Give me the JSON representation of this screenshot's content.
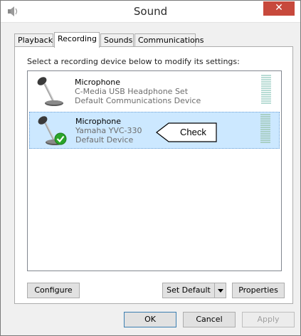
{
  "window": {
    "title": "Sound",
    "close_label": "✕"
  },
  "tabs": [
    {
      "label": "Playback",
      "active": false
    },
    {
      "label": "Recording",
      "active": true
    },
    {
      "label": "Sounds",
      "active": false
    },
    {
      "label": "Communications",
      "active": false
    }
  ],
  "panel": {
    "instructions": "Select a recording device below to modify its settings:"
  },
  "devices": [
    {
      "name": "Microphone",
      "model": "C-Media USB Headphone Set",
      "status": "Default Communications Device",
      "icon": "microphone-icon",
      "selected": false
    },
    {
      "name": "Microphone",
      "model": "Yamaha YVC-330",
      "status": "Default Device",
      "icon": "microphone-icon",
      "badge": "green-check-icon",
      "selected": true
    }
  ],
  "callout": {
    "text": "Check"
  },
  "buttons": {
    "configure": "Configure",
    "set_default": "Set Default",
    "properties": "Properties",
    "ok": "OK",
    "cancel": "Cancel",
    "apply": "Apply"
  },
  "colors": {
    "close": "#c7493c",
    "selection": "#cce8ff",
    "check": "#2aa52a"
  }
}
